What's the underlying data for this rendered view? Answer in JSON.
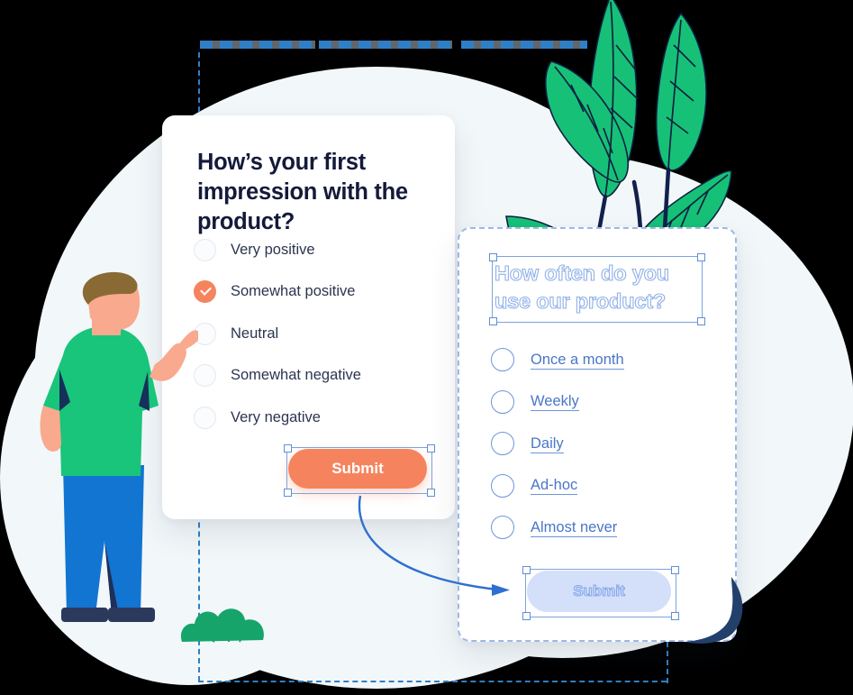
{
  "card1": {
    "title": "How’s your first impression with the product?",
    "options": [
      {
        "label": "Very positive",
        "selected": false
      },
      {
        "label": "Somewhat positive",
        "selected": true
      },
      {
        "label": "Neutral",
        "selected": false
      },
      {
        "label": "Somewhat negative",
        "selected": false
      },
      {
        "label": "Very negative",
        "selected": false
      }
    ],
    "submit_label": "Submit"
  },
  "card2": {
    "title": "How often do you use our product?",
    "options": [
      {
        "label": "Once a month"
      },
      {
        "label": "Weekly"
      },
      {
        "label": "Daily"
      },
      {
        "label": "Ad-hoc"
      },
      {
        "label": "Almost never"
      }
    ],
    "submit_label": "Submit"
  },
  "colors": {
    "accent_orange": "#F5845E",
    "wireframe_blue": "#6D95DC",
    "guide_blue": "#2F7FC6",
    "title_ink": "#141A3A",
    "background_blob": "#F2F7F9",
    "shirt_green": "#18C57A",
    "pants_blue": "#1275D1",
    "hair_brown": "#8A6A34",
    "skin": "#F8A98E",
    "leaf_green": "#16C177"
  }
}
